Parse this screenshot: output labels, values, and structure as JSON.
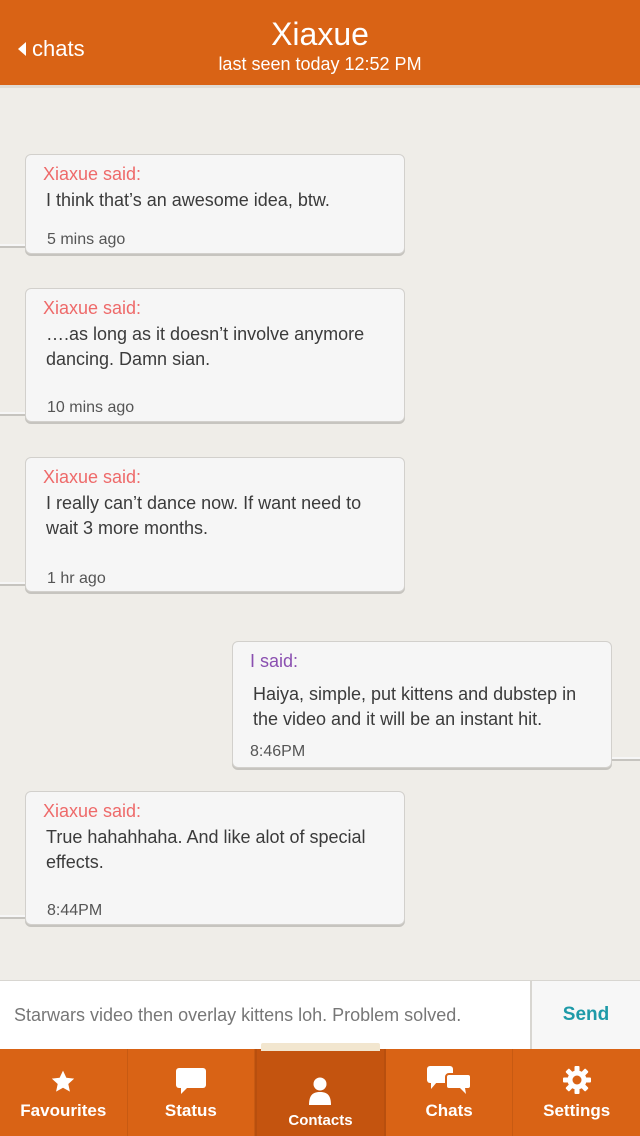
{
  "header": {
    "back_label": "chats",
    "title": "Xiaxue",
    "subtitle": "last seen today 12:52 PM"
  },
  "messages": [
    {
      "direction": "in",
      "sender": "Xiaxue said:",
      "text": "I think that’s an awesome idea, btw.",
      "time": "5 mins ago"
    },
    {
      "direction": "in",
      "sender": "Xiaxue said:",
      "text": "….as long as it doesn’t involve anymore dancing. Damn sian.",
      "time": "10 mins ago"
    },
    {
      "direction": "in",
      "sender": "Xiaxue said:",
      "text": "I really can’t dance now. If want need to wait 3 more months.",
      "time": "1 hr ago"
    },
    {
      "direction": "out",
      "sender": "I said:",
      "text": "Haiya, simple, put kittens and dubstep in the video and it will be an instant hit.",
      "time": "8:46PM"
    },
    {
      "direction": "in",
      "sender": "Xiaxue said:",
      "text": "True hahahhaha. And like alot of special effects.",
      "time": "8:44PM"
    }
  ],
  "compose": {
    "value": "Starwars video then overlay kittens loh. Problem solved.",
    "send_label": "Send"
  },
  "tabs": [
    {
      "label": "Favourites",
      "icon": "star-icon",
      "active": false
    },
    {
      "label": "Status",
      "icon": "speech-bubble-icon",
      "active": false
    },
    {
      "label": "Contacts",
      "icon": "person-icon",
      "active": true
    },
    {
      "label": "Chats",
      "icon": "chat-bubbles-icon",
      "active": false
    },
    {
      "label": "Settings",
      "icon": "gear-icon",
      "active": false
    }
  ],
  "colors": {
    "accent": "#d96315",
    "incoming_sender": "#ee6a6a",
    "outgoing_sender": "#8a4fb0",
    "send": "#1e9aa8",
    "background": "#efede8"
  }
}
